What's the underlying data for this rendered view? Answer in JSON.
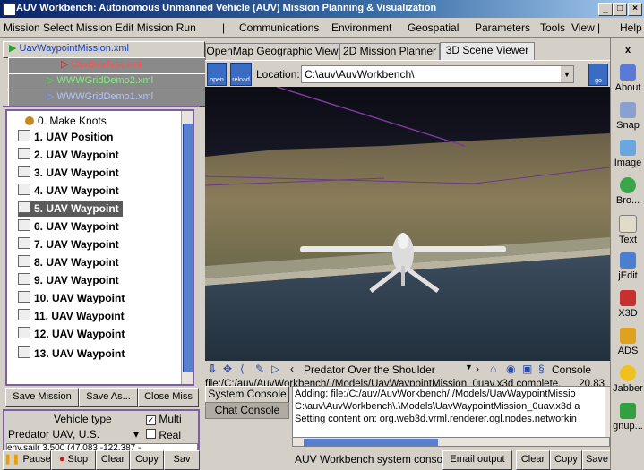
{
  "window": {
    "title": "AUV Workbench: Autonomous Unmanned Vehicle (AUV) Mission Planning & Visualization",
    "minimize": "_",
    "maximize": "□",
    "close": "×"
  },
  "menu": {
    "left": "Mission Select Mission Edit Mission Run",
    "sep1": "|",
    "communications": "Communications",
    "environment": "Environment",
    "geospatial": "Geospatial",
    "parameters": "Parameters",
    "tools": "Tools",
    "view": "View",
    "sep2": "|",
    "help": "Help"
  },
  "file_tabs": [
    {
      "label": "UavWaypointMission.xml",
      "color": "#1a3fb0"
    },
    {
      "label": "UsvBoxTest.xml",
      "color": "#d01818"
    },
    {
      "label": "WWWGridDemo2.xml",
      "color": "#2e9e2e"
    },
    {
      "label": "WWWGridDemo1.xml",
      "color": "#2a3ae0"
    }
  ],
  "tree": {
    "items": [
      {
        "label": "0. Make Knots",
        "bold": false
      },
      {
        "label": "1. UAV Position"
      },
      {
        "label": "2. UAV Waypoint"
      },
      {
        "label": "3. UAV Waypoint"
      },
      {
        "label": "4. UAV Waypoint"
      },
      {
        "label": "5. UAV Waypoint",
        "selected": true
      },
      {
        "label": "6. UAV Waypoint"
      },
      {
        "label": "7. UAV Waypoint"
      },
      {
        "label": "8. UAV Waypoint"
      },
      {
        "label": "9. UAV Waypoint"
      },
      {
        "label": "10. UAV Waypoint"
      },
      {
        "label": "11. UAV Waypoint"
      },
      {
        "label": "12. UAV Waypoint"
      },
      {
        "label": "13. UAV Waypoint"
      }
    ]
  },
  "mission_buttons": {
    "save": "Save Mission",
    "save_as": "Save As...",
    "close": "Close Miss"
  },
  "vehicle": {
    "label": "Vehicle type",
    "multi_label": "Multi",
    "multi_checked": true,
    "real_label": "Real",
    "real_checked": false,
    "selected": "Predator UAV, U.S.",
    "log_text": "env.sailr 3.500 (47.083 -122.387 -"
  },
  "run_buttons": {
    "pause": "Pause",
    "stop": "Stop",
    "clear": "Clear",
    "copy": "Copy",
    "save": "Sav"
  },
  "tabs": [
    {
      "label": "OpenMap Geographic View",
      "active": false
    },
    {
      "label": "2D Mission Planner",
      "active": false
    },
    {
      "label": "3D Scene Viewer",
      "active": true
    }
  ],
  "viewer_toolbar": {
    "open": "open",
    "reload": "reload",
    "location_label": "Location:",
    "location_value": "C:\\auv\\AuvWorkbench\\",
    "go": "go"
  },
  "nav_bar": {
    "viewpoint": "Predator Over the Shoulder",
    "console": "Console"
  },
  "status": {
    "text": "file:/C:/auv/AuvWorkbench/./Models/UavWaypointMission_0uav.x3d complete.",
    "fps": "20.83"
  },
  "console": {
    "system_tab": "System Console",
    "chat_tab": "Chat Console",
    "lines": [
      "Adding: file:/C:/auv/AuvWorkbench/./Models/UavWaypointMissio",
      "C:\\auv\\AuvWorkbench\\.\\Models\\UavWaypointMission_0uav.x3d a",
      "Setting content on: org.web3d.vrml.renderer.ogl.nodes.networkin"
    ],
    "footer_label": "AUV Workbench system console",
    "email": "Email output",
    "clear": "Clear",
    "copy": "Copy",
    "save": "Save"
  },
  "right_toolbar": {
    "close": "x",
    "about": "About",
    "snap": "Snap",
    "image": "Image",
    "browse": "Bro...",
    "text": "Text",
    "jedit": "jEdit",
    "x3d": "X3D",
    "ads": "ADS",
    "jabber": "Jabber",
    "gnup": "gnup..."
  }
}
